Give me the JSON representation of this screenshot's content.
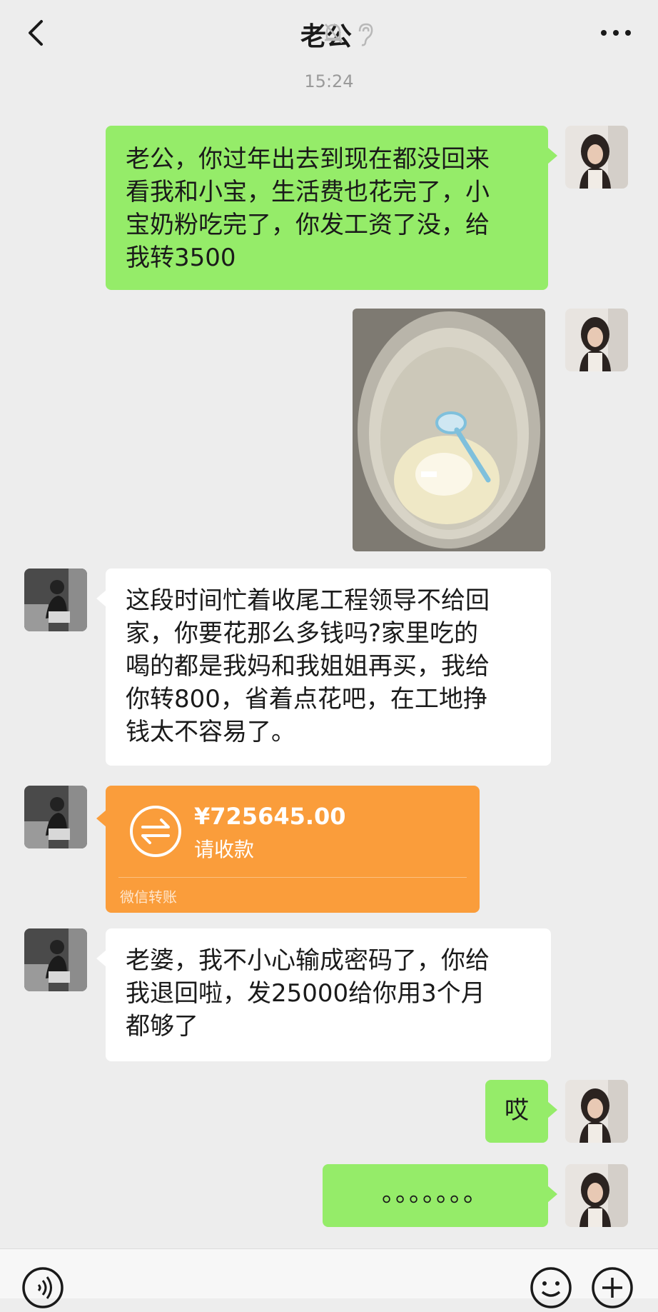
{
  "header": {
    "title": "老公",
    "back_icon": "chevron-left-icon",
    "mute_icon": "bell-muted-icon",
    "earpiece_icon": "ear-icon",
    "more_icon": "more-dots-icon"
  },
  "timestamp": "15:24",
  "messages": [
    {
      "id": "m1",
      "sender": "me",
      "type": "text",
      "text": "老公，你过年出去到现在都没回来\n看我和小宝，生活费也花完了，小\n宝奶粉吃完了，你发工资了没，给\n我转3500"
    },
    {
      "id": "m2",
      "sender": "me",
      "type": "image",
      "description": "milk-powder-can-photo"
    },
    {
      "id": "m3",
      "sender": "other",
      "type": "text",
      "text": "这段时间忙着收尾工程领导不给回\n家，你要花那么多钱吗?家里吃的\n喝的都是我妈和我姐姐再买，我给\n你转800，省着点花吧，在工地挣\n钱太不容易了。"
    },
    {
      "id": "m4",
      "sender": "other",
      "type": "transfer",
      "amount": "¥725645.00",
      "status": "请收款",
      "footer": "微信转账"
    },
    {
      "id": "m5",
      "sender": "other",
      "type": "text",
      "text": "老婆，我不小心输成密码了，你给\n我退回啦，发25000给你用3个月\n都够了"
    },
    {
      "id": "m6",
      "sender": "me",
      "type": "text",
      "text": "哎"
    },
    {
      "id": "m7",
      "sender": "me",
      "type": "text",
      "text": "。。。。。。。"
    }
  ],
  "colors": {
    "background": "#ededed",
    "my_bubble": "#95ec69",
    "other_bubble": "#ffffff",
    "transfer_card": "#fa9d3b"
  },
  "input_bar": {
    "voice_icon": "voice-icon",
    "emoji_icon": "emoji-icon",
    "plus_icon": "plus-icon"
  }
}
